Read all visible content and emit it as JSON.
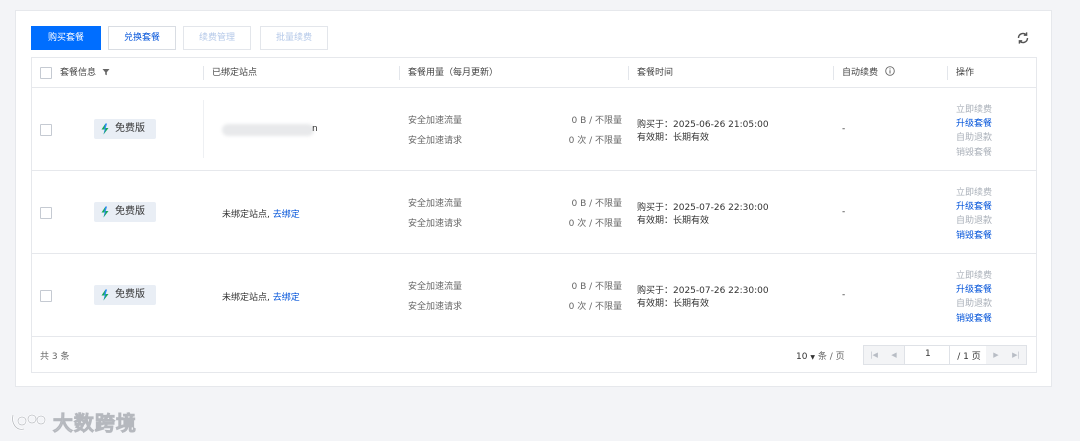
{
  "toolbar": {
    "buy_label": "购买套餐",
    "redeem_label": "兑换套餐",
    "renew_manage_label": "续费管理",
    "batch_renew_label": "批量续费"
  },
  "table": {
    "headers": {
      "plan_info": "套餐信息",
      "bound_site": "已绑定站点",
      "usage": "套餐用量（每月更新）",
      "time": "套餐时间",
      "auto_renew": "自动续费",
      "actions": "操作"
    },
    "rows": [
      {
        "plan": "免费版",
        "site_text": "",
        "site_suffix": "n",
        "site_link": "",
        "usage_traffic_label": "安全加速流量",
        "usage_traffic_value": "0 B / 不限量",
        "usage_request_label": "安全加速请求",
        "usage_request_value": "0 次 / 不限量",
        "purchased": "购买于：2025-06-26 21:05:00",
        "validity": "有效期：长期有效",
        "auto_renew": "-",
        "action_renew": "立即续费",
        "action_upgrade": "升级套餐",
        "action_refund": "自助退款",
        "action_destroy": "销毁套餐"
      },
      {
        "plan": "免费版",
        "site_text": "未绑定站点,",
        "site_suffix": "",
        "site_link": "去绑定",
        "usage_traffic_label": "安全加速流量",
        "usage_traffic_value": "0 B / 不限量",
        "usage_request_label": "安全加速请求",
        "usage_request_value": "0 次 / 不限量",
        "purchased": "购买于：2025-07-26 22:30:00",
        "validity": "有效期：长期有效",
        "auto_renew": "-",
        "action_renew": "立即续费",
        "action_upgrade": "升级套餐",
        "action_refund": "自助退款",
        "action_destroy": "销毁套餐"
      },
      {
        "plan": "免费版",
        "site_text": "未绑定站点,",
        "site_suffix": "",
        "site_link": "去绑定",
        "usage_traffic_label": "安全加速流量",
        "usage_traffic_value": "0 B / 不限量",
        "usage_request_label": "安全加速请求",
        "usage_request_value": "0 次 / 不限量",
        "purchased": "购买于：2025-07-26 22:30:00",
        "validity": "有效期：长期有效",
        "auto_renew": "-",
        "action_renew": "立即续费",
        "action_upgrade": "升级套餐",
        "action_refund": "自助退款",
        "action_destroy": "销毁套餐"
      }
    ],
    "footer": {
      "total": "共 3 条",
      "page_size": "10",
      "page_size_unit": "条 / 页",
      "current_page": "1",
      "total_pages": "/ 1 页"
    }
  },
  "watermark": {
    "text": "大数跨境"
  },
  "colors": {
    "primary": "#006eff",
    "link": "#0052d9",
    "disabled": "#aab0b9"
  }
}
